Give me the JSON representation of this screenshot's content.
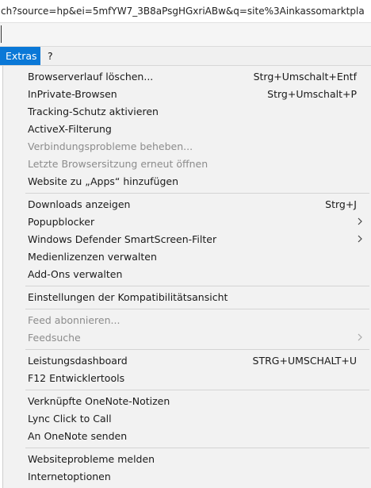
{
  "address_bar": {
    "url": "ch?source=hp&ei=5mfYW7_3B8aPsgHGxriABw&q=site%3Ainkassomarktpla"
  },
  "menubar": {
    "items": [
      {
        "label": "Extras"
      },
      {
        "label": "?"
      }
    ]
  },
  "menu": {
    "items": [
      {
        "label": "Browserverlauf löschen...",
        "shortcut": "Strg+Umschalt+Entf"
      },
      {
        "label": "InPrivate-Browsen",
        "shortcut": "Strg+Umschalt+P"
      },
      {
        "label": "Tracking-Schutz aktivieren",
        "shortcut": ""
      },
      {
        "label": "ActiveX-Filterung",
        "shortcut": ""
      },
      {
        "label": "Verbindungsprobleme beheben...",
        "shortcut": "",
        "disabled": true
      },
      {
        "label": "Letzte Browsersitzung erneut öffnen",
        "shortcut": "",
        "disabled": true
      },
      {
        "label": "Website zu „Apps“ hinzufügen",
        "shortcut": ""
      },
      {
        "label": "Downloads anzeigen",
        "shortcut": "Strg+J"
      },
      {
        "label": "Popupblocker",
        "shortcut": "",
        "submenu": true
      },
      {
        "label": "Windows Defender SmartScreen-Filter",
        "shortcut": "",
        "submenu": true
      },
      {
        "label": "Medienlizenzen verwalten",
        "shortcut": ""
      },
      {
        "label": "Add-Ons verwalten",
        "shortcut": ""
      },
      {
        "label": "Einstellungen der Kompatibilitätsansicht",
        "shortcut": ""
      },
      {
        "label": "Feed abonnieren...",
        "shortcut": "",
        "disabled": true
      },
      {
        "label": "Feedsuche",
        "shortcut": "",
        "disabled": true,
        "submenu": true
      },
      {
        "label": "Leistungsdashboard",
        "shortcut": "STRG+UMSCHALT+U"
      },
      {
        "label": "F12 Entwicklertools",
        "shortcut": ""
      },
      {
        "label": "Verknüpfte OneNote-Notizen",
        "shortcut": ""
      },
      {
        "label": "Lync Click to Call",
        "shortcut": ""
      },
      {
        "label": "An OneNote senden",
        "shortcut": ""
      },
      {
        "label": "Websiteprobleme melden",
        "shortcut": ""
      },
      {
        "label": "Internetoptionen",
        "shortcut": ""
      }
    ]
  }
}
